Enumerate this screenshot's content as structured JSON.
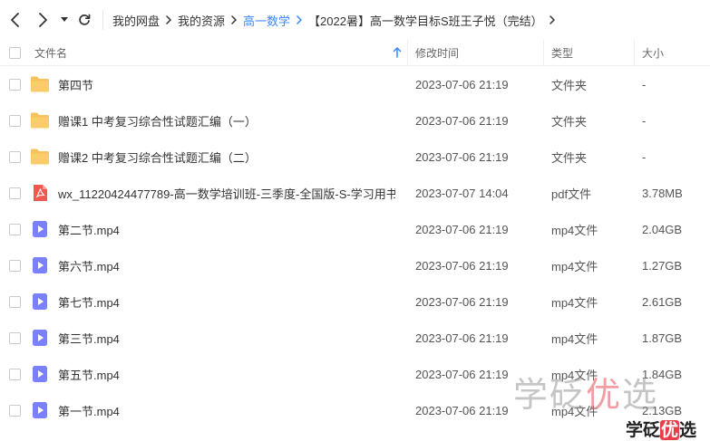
{
  "breadcrumb": [
    {
      "label": "我的网盘"
    },
    {
      "label": "我的资源"
    },
    {
      "label": "高一数学"
    },
    {
      "label": "【2022暑】高一数学目标S班王子悦（完结）"
    }
  ],
  "columns": {
    "name": "文件名",
    "time": "修改时间",
    "type": "类型",
    "size": "大小"
  },
  "colors": {
    "accent": "#3a86ff",
    "folder": "#f7c25c",
    "pdf": "#f1584f",
    "video": "#7b80ff"
  },
  "rows": [
    {
      "icon": "folder-icon",
      "name": "第四节",
      "time": "2023-07-06 21:19",
      "type": "文件夹",
      "size": "-"
    },
    {
      "icon": "folder-icon",
      "name": "赠课1 中考复习综合性试题汇编（一）",
      "time": "2023-07-06 21:19",
      "type": "文件夹",
      "size": "-"
    },
    {
      "icon": "folder-icon",
      "name": "赠课2 中考复习综合性试题汇编（二）",
      "time": "2023-07-06 21:19",
      "type": "文件夹",
      "size": "-"
    },
    {
      "icon": "pdf-icon",
      "name": "wx_11220424477789-高一数学培训班-三季度-全国版-S-学习用书-...",
      "time": "2023-07-07 14:04",
      "type": "pdf文件",
      "size": "3.78MB"
    },
    {
      "icon": "video-icon",
      "name": "第二节.mp4",
      "time": "2023-07-06 21:19",
      "type": "mp4文件",
      "size": "2.04GB"
    },
    {
      "icon": "video-icon",
      "name": "第六节.mp4",
      "time": "2023-07-06 21:19",
      "type": "mp4文件",
      "size": "1.27GB"
    },
    {
      "icon": "video-icon",
      "name": "第七节.mp4",
      "time": "2023-07-06 21:19",
      "type": "mp4文件",
      "size": "2.61GB"
    },
    {
      "icon": "video-icon",
      "name": "第三节.mp4",
      "time": "2023-07-06 21:19",
      "type": "mp4文件",
      "size": "1.87GB"
    },
    {
      "icon": "video-icon",
      "name": "第五节.mp4",
      "time": "2023-07-06 21:19",
      "type": "mp4文件",
      "size": "1.84GB"
    },
    {
      "icon": "video-icon",
      "name": "第一节.mp4",
      "time": "2023-07-06 21:19",
      "type": "mp4文件",
      "size": "2.13GB"
    }
  ],
  "watermark": {
    "big_pre": "学砭",
    "big_hl": "优",
    "big_post": "选",
    "small_pre": "学砭",
    "small_hl": "优",
    "small_post": "选"
  }
}
